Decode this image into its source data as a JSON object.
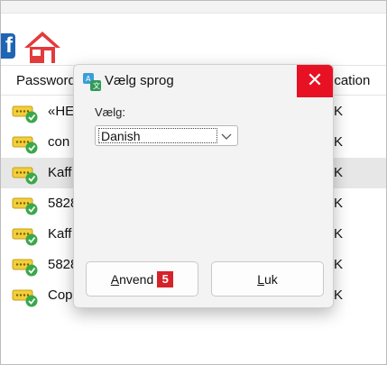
{
  "toolbar": {
    "fb_icon_glyph": "f",
    "home_icon": "home-icon"
  },
  "table": {
    "headers": {
      "password": "Passwords",
      "application": "ication"
    },
    "rows": [
      {
        "text": "«HE",
        "k": "K",
        "selected": false
      },
      {
        "text": "con",
        "k": "K",
        "selected": false
      },
      {
        "text": "Kaff",
        "k": "K",
        "selected": true
      },
      {
        "text": "5828",
        "k": "K",
        "selected": false
      },
      {
        "text": "Kaff",
        "k": "K",
        "selected": false
      },
      {
        "text": "5828",
        "k": "K",
        "selected": false
      },
      {
        "text": "Cop",
        "k": "K",
        "selected": false
      }
    ]
  },
  "dialog": {
    "title": "Vælg sprog",
    "close_glyph": "✕",
    "label": "Vælg:",
    "language_value": "Danish",
    "apply_label_first": "A",
    "apply_label_rest": "nvend",
    "step_badge": "5",
    "close_label_first": "L",
    "close_label_rest": "uk"
  },
  "colors": {
    "close_red": "#e81123",
    "badge_red": "#d6232a",
    "key_yellow": "#f1cf3b",
    "check_green": "#3aa84a"
  }
}
